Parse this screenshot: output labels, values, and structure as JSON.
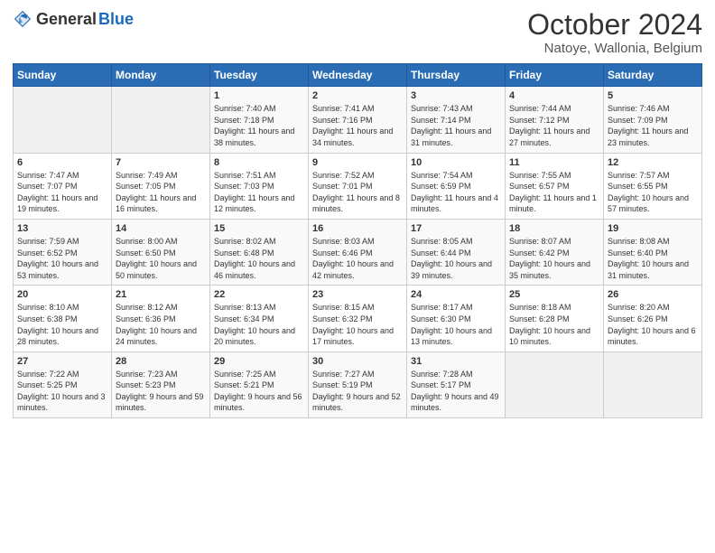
{
  "header": {
    "logo_general": "General",
    "logo_blue": "Blue",
    "title": "October 2024",
    "subtitle": "Natoye, Wallonia, Belgium"
  },
  "columns": [
    "Sunday",
    "Monday",
    "Tuesday",
    "Wednesday",
    "Thursday",
    "Friday",
    "Saturday"
  ],
  "weeks": [
    [
      {
        "day": "",
        "info": ""
      },
      {
        "day": "",
        "info": ""
      },
      {
        "day": "1",
        "info": "Sunrise: 7:40 AM\nSunset: 7:18 PM\nDaylight: 11 hours and 38 minutes."
      },
      {
        "day": "2",
        "info": "Sunrise: 7:41 AM\nSunset: 7:16 PM\nDaylight: 11 hours and 34 minutes."
      },
      {
        "day": "3",
        "info": "Sunrise: 7:43 AM\nSunset: 7:14 PM\nDaylight: 11 hours and 31 minutes."
      },
      {
        "day": "4",
        "info": "Sunrise: 7:44 AM\nSunset: 7:12 PM\nDaylight: 11 hours and 27 minutes."
      },
      {
        "day": "5",
        "info": "Sunrise: 7:46 AM\nSunset: 7:09 PM\nDaylight: 11 hours and 23 minutes."
      }
    ],
    [
      {
        "day": "6",
        "info": "Sunrise: 7:47 AM\nSunset: 7:07 PM\nDaylight: 11 hours and 19 minutes."
      },
      {
        "day": "7",
        "info": "Sunrise: 7:49 AM\nSunset: 7:05 PM\nDaylight: 11 hours and 16 minutes."
      },
      {
        "day": "8",
        "info": "Sunrise: 7:51 AM\nSunset: 7:03 PM\nDaylight: 11 hours and 12 minutes."
      },
      {
        "day": "9",
        "info": "Sunrise: 7:52 AM\nSunset: 7:01 PM\nDaylight: 11 hours and 8 minutes."
      },
      {
        "day": "10",
        "info": "Sunrise: 7:54 AM\nSunset: 6:59 PM\nDaylight: 11 hours and 4 minutes."
      },
      {
        "day": "11",
        "info": "Sunrise: 7:55 AM\nSunset: 6:57 PM\nDaylight: 11 hours and 1 minute."
      },
      {
        "day": "12",
        "info": "Sunrise: 7:57 AM\nSunset: 6:55 PM\nDaylight: 10 hours and 57 minutes."
      }
    ],
    [
      {
        "day": "13",
        "info": "Sunrise: 7:59 AM\nSunset: 6:52 PM\nDaylight: 10 hours and 53 minutes."
      },
      {
        "day": "14",
        "info": "Sunrise: 8:00 AM\nSunset: 6:50 PM\nDaylight: 10 hours and 50 minutes."
      },
      {
        "day": "15",
        "info": "Sunrise: 8:02 AM\nSunset: 6:48 PM\nDaylight: 10 hours and 46 minutes."
      },
      {
        "day": "16",
        "info": "Sunrise: 8:03 AM\nSunset: 6:46 PM\nDaylight: 10 hours and 42 minutes."
      },
      {
        "day": "17",
        "info": "Sunrise: 8:05 AM\nSunset: 6:44 PM\nDaylight: 10 hours and 39 minutes."
      },
      {
        "day": "18",
        "info": "Sunrise: 8:07 AM\nSunset: 6:42 PM\nDaylight: 10 hours and 35 minutes."
      },
      {
        "day": "19",
        "info": "Sunrise: 8:08 AM\nSunset: 6:40 PM\nDaylight: 10 hours and 31 minutes."
      }
    ],
    [
      {
        "day": "20",
        "info": "Sunrise: 8:10 AM\nSunset: 6:38 PM\nDaylight: 10 hours and 28 minutes."
      },
      {
        "day": "21",
        "info": "Sunrise: 8:12 AM\nSunset: 6:36 PM\nDaylight: 10 hours and 24 minutes."
      },
      {
        "day": "22",
        "info": "Sunrise: 8:13 AM\nSunset: 6:34 PM\nDaylight: 10 hours and 20 minutes."
      },
      {
        "day": "23",
        "info": "Sunrise: 8:15 AM\nSunset: 6:32 PM\nDaylight: 10 hours and 17 minutes."
      },
      {
        "day": "24",
        "info": "Sunrise: 8:17 AM\nSunset: 6:30 PM\nDaylight: 10 hours and 13 minutes."
      },
      {
        "day": "25",
        "info": "Sunrise: 8:18 AM\nSunset: 6:28 PM\nDaylight: 10 hours and 10 minutes."
      },
      {
        "day": "26",
        "info": "Sunrise: 8:20 AM\nSunset: 6:26 PM\nDaylight: 10 hours and 6 minutes."
      }
    ],
    [
      {
        "day": "27",
        "info": "Sunrise: 7:22 AM\nSunset: 5:25 PM\nDaylight: 10 hours and 3 minutes."
      },
      {
        "day": "28",
        "info": "Sunrise: 7:23 AM\nSunset: 5:23 PM\nDaylight: 9 hours and 59 minutes."
      },
      {
        "day": "29",
        "info": "Sunrise: 7:25 AM\nSunset: 5:21 PM\nDaylight: 9 hours and 56 minutes."
      },
      {
        "day": "30",
        "info": "Sunrise: 7:27 AM\nSunset: 5:19 PM\nDaylight: 9 hours and 52 minutes."
      },
      {
        "day": "31",
        "info": "Sunrise: 7:28 AM\nSunset: 5:17 PM\nDaylight: 9 hours and 49 minutes."
      },
      {
        "day": "",
        "info": ""
      },
      {
        "day": "",
        "info": ""
      }
    ]
  ]
}
